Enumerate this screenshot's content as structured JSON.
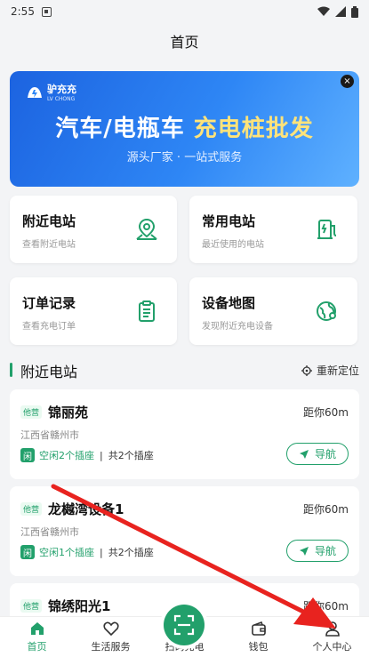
{
  "statusbar": {
    "time": "2:55"
  },
  "header": {
    "title": "首页"
  },
  "banner": {
    "logo_text": "驴充充",
    "logo_sub": "LV CHONG",
    "headline_a": "汽车/电瓶车 ",
    "headline_b": "充电桩批发",
    "tagline": "源头厂家 · 一站式服务",
    "close_label": "×"
  },
  "cards": [
    {
      "title": "附近电站",
      "desc": "查看附近电站",
      "icon": "map-pin-icon"
    },
    {
      "title": "常用电站",
      "desc": "最近使用的电站",
      "icon": "charger-icon"
    },
    {
      "title": "订单记录",
      "desc": "查看充电订单",
      "icon": "clipboard-icon"
    },
    {
      "title": "设备地图",
      "desc": "发现附近充电设备",
      "icon": "globe-pin-icon"
    }
  ],
  "section": {
    "title": "附近电站",
    "relocate": "重新定位"
  },
  "stations": [
    {
      "tag": "他营",
      "name": "锦丽苑",
      "distance": "距你60m",
      "address": "江西省赣州市",
      "free_box": "闲",
      "free": "空闲2个插座",
      "total": "共2个插座",
      "nav": "导航"
    },
    {
      "tag": "他营",
      "name": "龙樾湾设备1",
      "distance": "距你60m",
      "address": "江西省赣州市",
      "free_box": "闲",
      "free": "空闲1个插座",
      "total": "共2个插座",
      "nav": "导航"
    },
    {
      "tag": "他营",
      "name": "锦绣阳光1",
      "distance": "距你60m"
    }
  ],
  "tabbar": {
    "items": [
      {
        "label": "首页",
        "icon": "home-icon"
      },
      {
        "label": "生活服务",
        "icon": "heart-icon"
      },
      {
        "label": "扫码充电",
        "icon": "scan-icon"
      },
      {
        "label": "钱包",
        "icon": "wallet-icon"
      },
      {
        "label": "个人中心",
        "icon": "user-icon"
      }
    ]
  },
  "colors": {
    "accent": "#22a06b",
    "banner": "#2e86f5",
    "annotation_arrow": "#e8231f"
  }
}
